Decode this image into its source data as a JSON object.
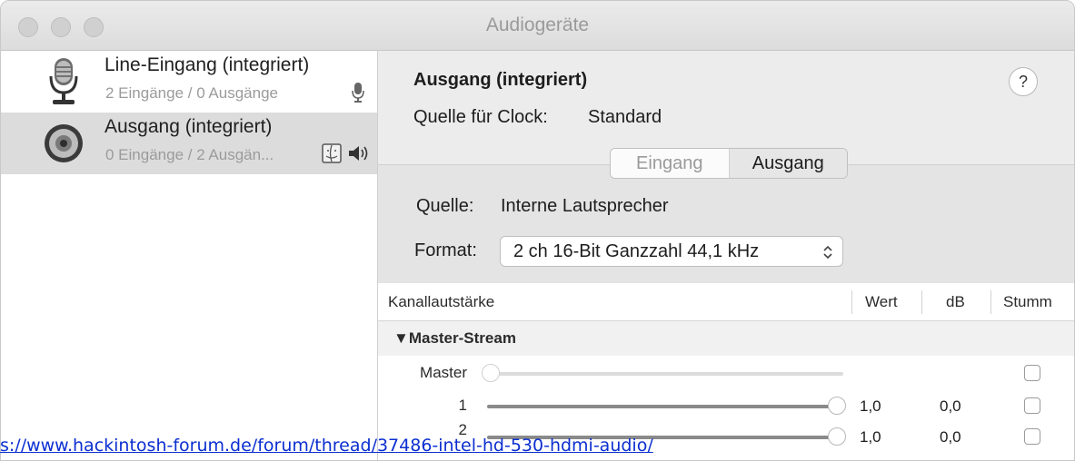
{
  "window": {
    "title": "Audiogeräte"
  },
  "sidebar": {
    "devices": [
      {
        "name": "Line-Eingang (integriert)",
        "subtitle": "2 Eingänge / 0 Ausgänge",
        "icon": "microphone-icon",
        "selected": false
      },
      {
        "name": "Ausgang (integriert)",
        "subtitle": "0 Eingänge / 2 Ausgän...",
        "icon": "speaker-icon",
        "selected": true
      }
    ]
  },
  "main": {
    "title": "Ausgang (integriert)",
    "clock_label": "Quelle für Clock:",
    "clock_value": "Standard",
    "help_label": "?",
    "tabs": [
      {
        "label": "Eingang",
        "selected": false
      },
      {
        "label": "Ausgang",
        "selected": true
      }
    ],
    "source_label": "Quelle:",
    "source_value": "Interne Lautsprecher",
    "format_label": "Format:",
    "format_value": "2 ch 16-Bit Ganzzahl 44,1 kHz",
    "format_arrow": "⌃⌄"
  },
  "table": {
    "headers": {
      "channel": "Kanallautstärke",
      "value": "Wert",
      "db": "dB",
      "mute": "Stumm"
    },
    "group": "▼Master-Stream",
    "rows": [
      {
        "label": "Master",
        "value": "",
        "db": "",
        "level": 0.0,
        "enabled": false,
        "muted": false
      },
      {
        "label": "1",
        "value": "1,0",
        "db": "0,0",
        "level": 1.0,
        "enabled": true,
        "muted": false
      },
      {
        "label": "2",
        "value": "1,0",
        "db": "0,0",
        "level": 1.0,
        "enabled": true,
        "muted": false
      }
    ]
  },
  "overlay_url": "s://www.hackintosh-forum.de/forum/thread/37486-intel-hd-530-hdmi-audio/",
  "colors": {
    "link": "#0b2fd1",
    "selection": "#dcdcdc",
    "track_active": "#8a8a8a",
    "track_inactive": "#dcdcdc"
  }
}
